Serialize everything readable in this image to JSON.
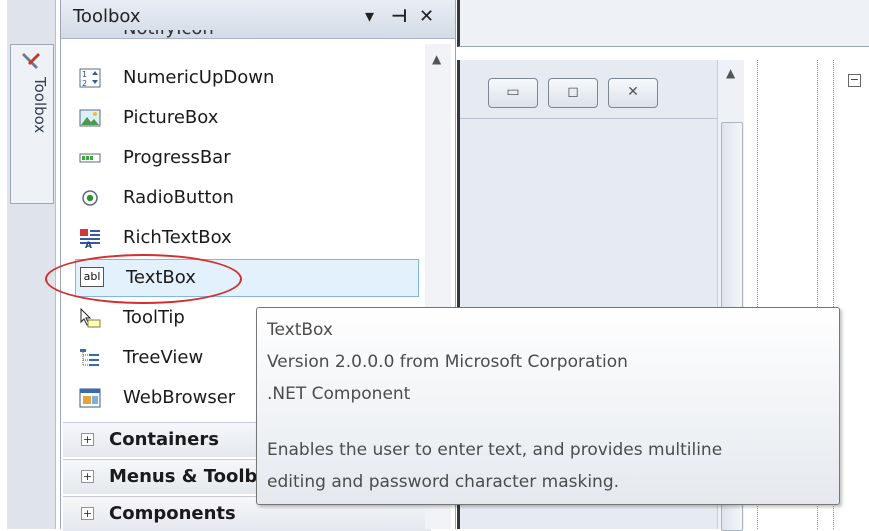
{
  "left_tab": {
    "label": "Toolbox",
    "icon": "toolbox-tools-icon"
  },
  "toolbox": {
    "title": "Toolbox",
    "header_buttons": {
      "dropdown": "▾",
      "pin": "⊣",
      "close": "✕"
    },
    "partial_item": "NotifyIcon",
    "items": [
      {
        "label": "NumericUpDown",
        "icon": "numeric-updown-icon"
      },
      {
        "label": "PictureBox",
        "icon": "picturebox-icon"
      },
      {
        "label": "ProgressBar",
        "icon": "progressbar-icon"
      },
      {
        "label": "RadioButton",
        "icon": "radiobutton-icon"
      },
      {
        "label": "RichTextBox",
        "icon": "richtextbox-icon"
      },
      {
        "label": "TextBox",
        "icon": "textbox-icon",
        "icon_text": "abl",
        "selected": true
      },
      {
        "label": "ToolTip",
        "icon": "tooltip-icon"
      },
      {
        "label": "TreeView",
        "icon": "treeview-icon"
      },
      {
        "label": "WebBrowser",
        "icon": "webbrowser-icon"
      }
    ],
    "categories": [
      {
        "label": "Containers",
        "expander": "+"
      },
      {
        "label": "Menus & Toolbars",
        "expander": "+"
      },
      {
        "label": "Components",
        "expander": "+"
      }
    ]
  },
  "form_caption": {
    "minimize": "▭",
    "maximize": "◻",
    "close": "✕"
  },
  "doc_collapse": "−",
  "tooltip": {
    "title": "TextBox",
    "version": "Version 2.0.0.0 from Microsoft Corporation",
    "type": ".NET Component",
    "desc_line1": "Enables the user to enter text, and provides multiline",
    "desc_line2": "editing and password character masking."
  },
  "colors": {
    "highlight_ring": "#d32f2f",
    "selection_bg": "#e2f1fc",
    "selection_border": "#7fb8e6"
  }
}
